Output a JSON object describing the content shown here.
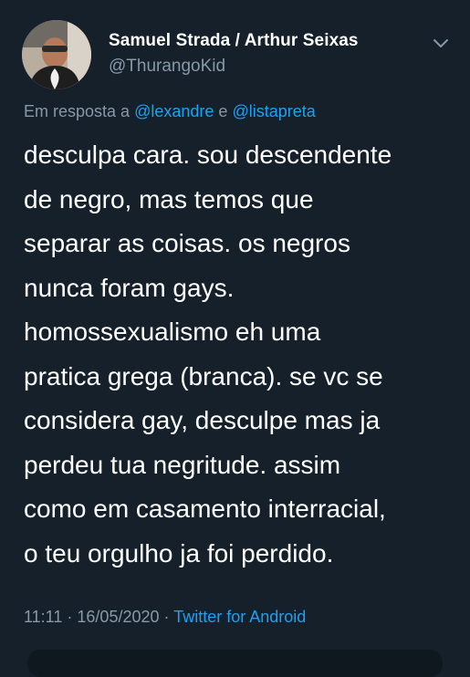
{
  "tweet": {
    "author": {
      "display_name": "Samuel Strada / Arthur Seixas",
      "handle": "@ThurangoKid"
    },
    "reply": {
      "prefix": "Em resposta a",
      "mention_1": "@lexandre",
      "joiner": "e",
      "mention_2": "@listapreta"
    },
    "text": "desculpa cara. sou descendente\nde negro, mas temos que\nseparar as coisas. os negros\nnunca foram gays.\nhomossexualismo eh uma\npratica grega (branca). se vc se\nconsidera gay, desculpe mas ja\nperdeu tua negritude. assim\ncomo em casamento interracial,\no teu orgulho ja foi perdido.",
    "time": "11:11",
    "date": "16/05/2020",
    "separator": "·",
    "source": "Twitter for Android"
  },
  "icons": {
    "more_menu": "chevron-down-icon",
    "avatar": "user-avatar"
  },
  "colors": {
    "background": "#15202b",
    "text": "#ffffff",
    "secondary": "#8899a6",
    "accent": "#1da1f2"
  }
}
